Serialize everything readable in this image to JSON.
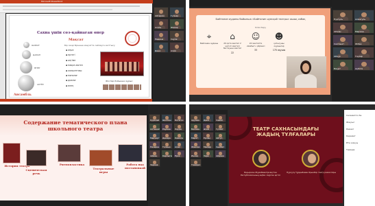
{
  "q1": {
    "window_title": "Microsoft PowerPoint",
    "slide_title": "Сахна үшін сөз-қайнаған өнер",
    "section_title": "Мақсат",
    "lead_text": "Бір сөзді бірнеше мақсатта сөйлеуге жаттығу",
    "bullets": [
      "аңыз",
      "ертегі",
      "әңгіме",
      "мақал-мәтел",
      "жаңылтпаш",
      "монолог",
      "диалог",
      "өлең"
    ],
    "orb_labels": [
      "ШАБЫТ",
      "ДАРЫН",
      "ӨНЕР",
      "АКТЁР"
    ],
    "bottom_label": "Ансамбль",
    "caption": "Жоспар бойынша жұмыс",
    "participants": [
      "Айгерим",
      "Гүлнар",
      "Асель",
      "Жанар",
      "Мадина",
      "Сәуле",
      "Дина",
      "Алия"
    ]
  },
  "q2": {
    "title": "Байғанин ауданы бойынша «Байғанин әуесқой театры» ашық сабақ",
    "subtitle": "білім беру",
    "items": [
      {
        "icon": "location-pin-icon",
        "text": "Байғанин ауданы",
        "value": ""
      },
      {
        "icon": "school-building-icon",
        "text": "20 орта мектеп 2 негізгі мектеп бастауыш мектеп",
        "value": "22"
      },
      {
        "icon": "theater-masks-icon",
        "text": "22 мектепте «Шабыт» үйірмесі",
        "value": "33"
      },
      {
        "icon": "students-icon",
        "text": "қатысушы оқушылар",
        "value": "170 оқушы"
      }
    ],
    "participants": [
      "Нургуль",
      "Алмагуль",
      "Айжан",
      "Маржан",
      "Салтанат",
      "Жібек",
      "Айнұр",
      "Гаухар",
      "Бақыт",
      "Ақбота"
    ]
  },
  "q3": {
    "title": "Содержание тематического плана школьного театра",
    "labels": [
      "История театра",
      "Сценическая речь",
      "Ритмопластика",
      "Театральные игры",
      "Работа над постановкой"
    ],
    "participants": [
      "Куралай",
      "Шолпан",
      "Ботагоз",
      "Алтынай",
      "Раушан",
      "Лаура",
      "Меруерт",
      "Динара",
      "Камила",
      "Назерке",
      "Толкын",
      "Асем",
      "Айман",
      "Карлыгаш",
      "Ерке",
      "Зарина"
    ]
  },
  "q4": {
    "title": "ТЕАТР САХНАСЫНДАҒЫ ЖАДЫҢ ТҰЛҒАЛАРЫ",
    "person_left": "Бауыржан Жұмабаев Қазақстан Республикасының еңбек сіңірген әртісі",
    "person_right": "Нұрсұлу Тұрдыбаева Орынбор театр режиссёры",
    "participants": [
      "Аружан",
      "Дана",
      "Самал",
      "Балжан",
      "Әсем",
      "Гүлзат",
      "Марат",
      "Ерлан",
      "Айгүл",
      "Жансая",
      "Мөлдір",
      "Сымбат",
      "Инкар",
      "Зере",
      "Айдана",
      "Томирис"
    ],
    "chat_lines": [
      "Сәлеметсіз бе",
      "Жақсы!",
      "Рахмет",
      "Керемет",
      "Өте жақсы",
      "Тамаша"
    ]
  }
}
